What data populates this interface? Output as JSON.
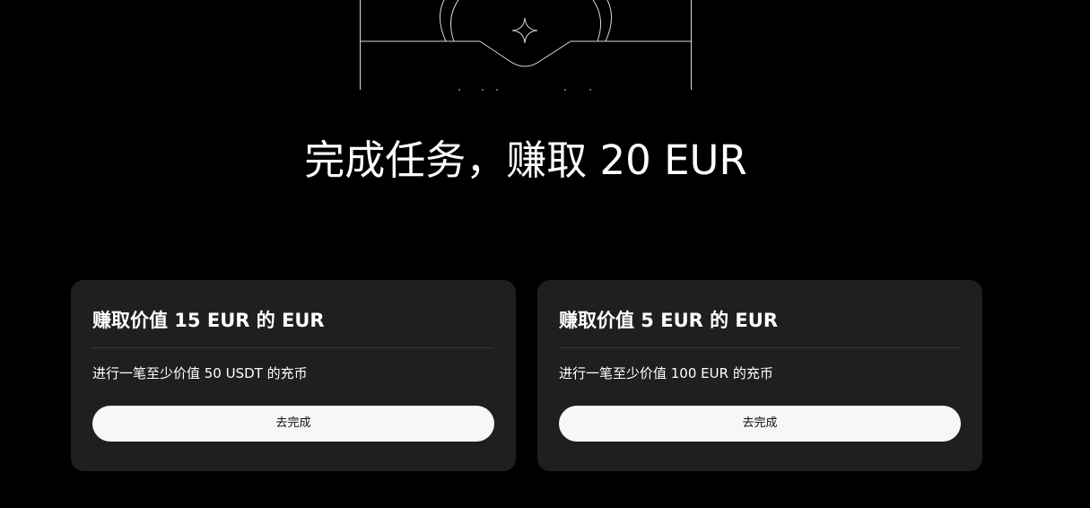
{
  "hero": {
    "title": "完成任务，赚取 20 EUR"
  },
  "tasks": [
    {
      "title": "赚取价值 15 EUR 的 EUR",
      "description": "进行一笔至少价值 50 USDT 的充币",
      "button_label": "去完成"
    },
    {
      "title": "赚取价值 5 EUR 的 EUR",
      "description": "进行一笔至少价值 100 EUR 的充币",
      "button_label": "去完成"
    }
  ],
  "colors": {
    "background": "#000000",
    "card_background": "#1f1f1f",
    "button_background": "#f7f7f7",
    "text_primary": "#ffffff"
  }
}
